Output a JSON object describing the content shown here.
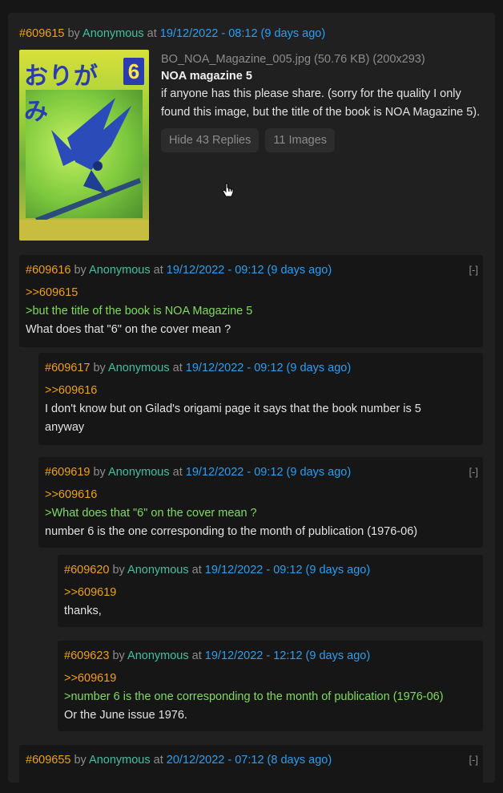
{
  "op": {
    "num": "#609615",
    "by": "by",
    "name": "Anonymous",
    "at": "at",
    "date": "19/12/2022 - 08:12 (9 days ago)",
    "file": "BO_NOA_Magazine_005.jpg (50.76 KB) (200x293)",
    "title": "NOA magazine 5",
    "text": "if anyone has this please share. (sorry for the quality I only found this image, but the title of the book is NOA Magazine 5).",
    "hide_label": "Hide 43 Replies",
    "images_label": "11 Images",
    "thumb_title": "おりがみ",
    "thumb_issue": "6"
  },
  "collapse_label": "[-]",
  "replies": [
    {
      "num": "#609616",
      "by": "by",
      "name": "Anonymous",
      "at": "at",
      "date": "19/12/2022 - 09:12 (9 days ago)",
      "quote": ">>609615",
      "green": ">but the title of the book is NOA Magazine 5",
      "text1": "What does that \"6\" on the cover mean ?"
    },
    {
      "num": "#609617",
      "by": "by",
      "name": "Anonymous",
      "at": "at",
      "date": "19/12/2022 - 09:12 (9 days ago)",
      "quote": ">>609616",
      "text1": "I don't know but on Gilad's origami page it says that the book number is 5",
      "text2": "anyway"
    },
    {
      "num": "#609619",
      "by": "by",
      "name": "Anonymous",
      "at": "at",
      "date": "19/12/2022 - 09:12 (9 days ago)",
      "quote": ">>609616",
      "green": ">What does that \"6\" on the cover mean ?",
      "text1": "number 6 is the one corresponding to the month of publication (1976-06)"
    },
    {
      "num": "#609620",
      "by": "by",
      "name": "Anonymous",
      "at": "at",
      "date": "19/12/2022 - 09:12 (9 days ago)",
      "quote": ">>609619",
      "text1": "thanks,"
    },
    {
      "num": "#609623",
      "by": "by",
      "name": "Anonymous",
      "at": "at",
      "date": "19/12/2022 - 12:12 (9 days ago)",
      "quote": ">>609619",
      "green": ">number 6 is the one corresponding to the month of publication (1976-06)",
      "text1": "Or the June issue 1976."
    },
    {
      "num": "#609655",
      "by": "by",
      "name": "Anonymous",
      "at": "at",
      "date": "20/12/2022 - 07:12 (8 days ago)"
    }
  ]
}
